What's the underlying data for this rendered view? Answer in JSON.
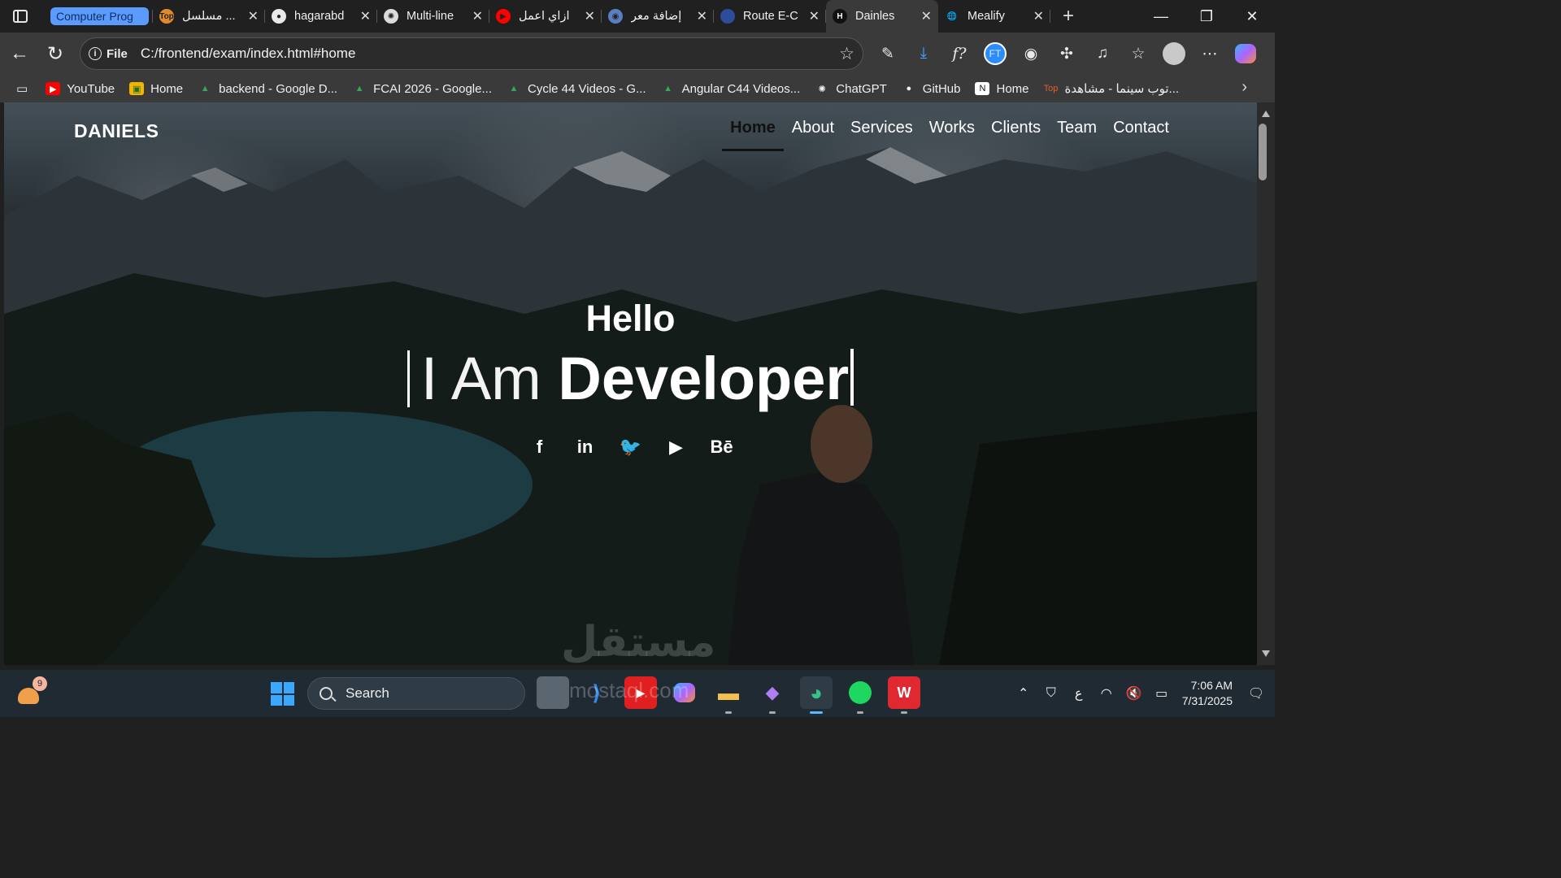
{
  "tabs": [
    {
      "title": "Computer Prog",
      "type": "group"
    },
    {
      "title": "مسلسل ...",
      "icon": "top-cinema-icon",
      "favColor": "#e08a2e",
      "favText": "Top"
    },
    {
      "title": "hagarabd",
      "icon": "github-icon",
      "favColor": "#e9e9e9",
      "favText": "●"
    },
    {
      "title": "Multi-line",
      "icon": "chatgpt-icon",
      "favColor": "#dcdcdc",
      "favText": "✺"
    },
    {
      "title": "ازاي اعمل",
      "icon": "youtube-icon",
      "favColor": "#ff0000",
      "favText": "▶"
    },
    {
      "title": "إضافة معر",
      "icon": "circle-icon",
      "favColor": "#5a7fc0",
      "favText": "◉"
    },
    {
      "title": "Route E-C",
      "icon": "route-icon",
      "favColor": "#2f4c9a",
      "favText": ""
    },
    {
      "title": "Dainles",
      "icon": "site-h-icon",
      "favColor": "#111",
      "favText": "H",
      "active": true
    },
    {
      "title": "Mealify",
      "icon": "globe-icon",
      "favColor": "transparent",
      "favText": "🌐"
    }
  ],
  "address": {
    "site_label": "File",
    "url": "C:/frontend/exam/index.html#home"
  },
  "bookmarks": [
    {
      "label": "YouTube",
      "icon": "youtube-icon"
    },
    {
      "label": "Home",
      "icon": "classroom-icon"
    },
    {
      "label": "backend - Google D...",
      "icon": "google-drive-icon"
    },
    {
      "label": "FCAI 2026 - Google...",
      "icon": "google-drive-icon"
    },
    {
      "label": "Cycle 44 Videos - G...",
      "icon": "google-drive-icon"
    },
    {
      "label": "Angular C44 Videos...",
      "icon": "google-drive-icon"
    },
    {
      "label": "ChatGPT",
      "icon": "chatgpt-icon"
    },
    {
      "label": "GitHub",
      "icon": "github-icon"
    },
    {
      "label": "Home",
      "icon": "notion-icon"
    },
    {
      "label": "توب سينما - مشاهدة...",
      "icon": "top-cinema-icon"
    }
  ],
  "page": {
    "brand": "DANIELS",
    "nav": [
      "Home",
      "About",
      "Services",
      "Works",
      "Clients",
      "Team",
      "Contact"
    ],
    "active_nav": "Home",
    "hero_hello": "Hello",
    "hero_prefix": "I Am",
    "hero_role": "Developer",
    "socials": [
      {
        "name": "facebook-icon",
        "glyph": "f"
      },
      {
        "name": "linkedin-icon",
        "glyph": "in"
      },
      {
        "name": "twitter-icon",
        "glyph": "🐦"
      },
      {
        "name": "youtube-icon",
        "glyph": "▶"
      },
      {
        "name": "behance-icon",
        "glyph": "Bē"
      }
    ]
  },
  "taskbar": {
    "search_placeholder": "Search",
    "weather_badge": "9",
    "time": "7:06 AM",
    "date": "7/31/2025",
    "lang": "ع",
    "watermark": "مستقل",
    "watermark_sub": "mostaql.com"
  },
  "colors": {
    "accent_group": "#5b9bff",
    "tab_active": "#3a3a3a",
    "taskbar": "#1f2a33"
  }
}
